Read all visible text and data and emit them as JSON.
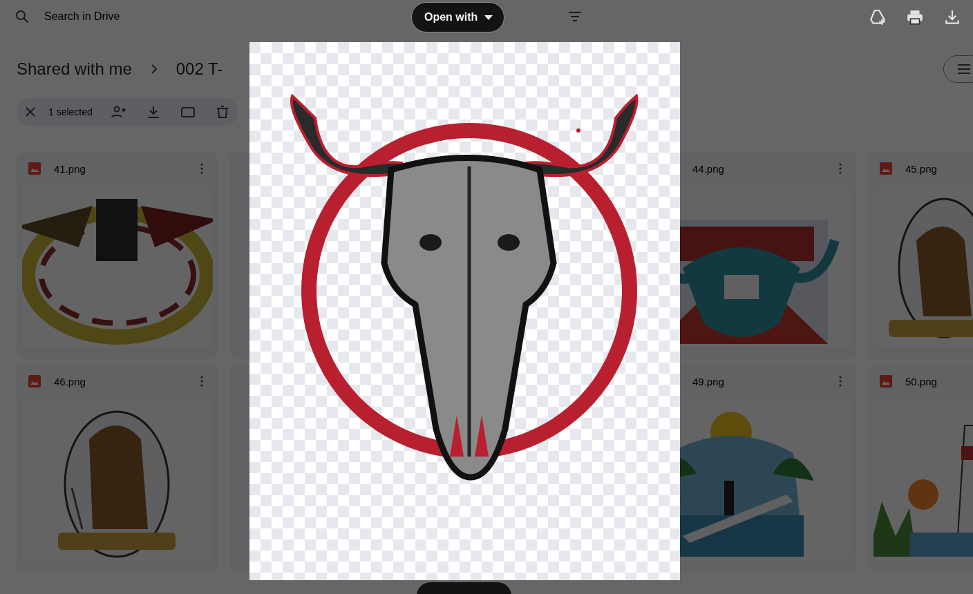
{
  "search": {
    "placeholder": "Search in Drive"
  },
  "breadcrumb": [
    "Shared with me",
    "002 T-"
  ],
  "selection_bar": {
    "count": "1 selected"
  },
  "files": [
    {
      "name": "41.png"
    },
    {
      "name": "44.png"
    },
    {
      "name": "45.png"
    },
    {
      "name": "46.png"
    },
    {
      "name": "49.png"
    },
    {
      "name": "50.png"
    }
  ],
  "viewer": {
    "open_with": "Open with"
  }
}
